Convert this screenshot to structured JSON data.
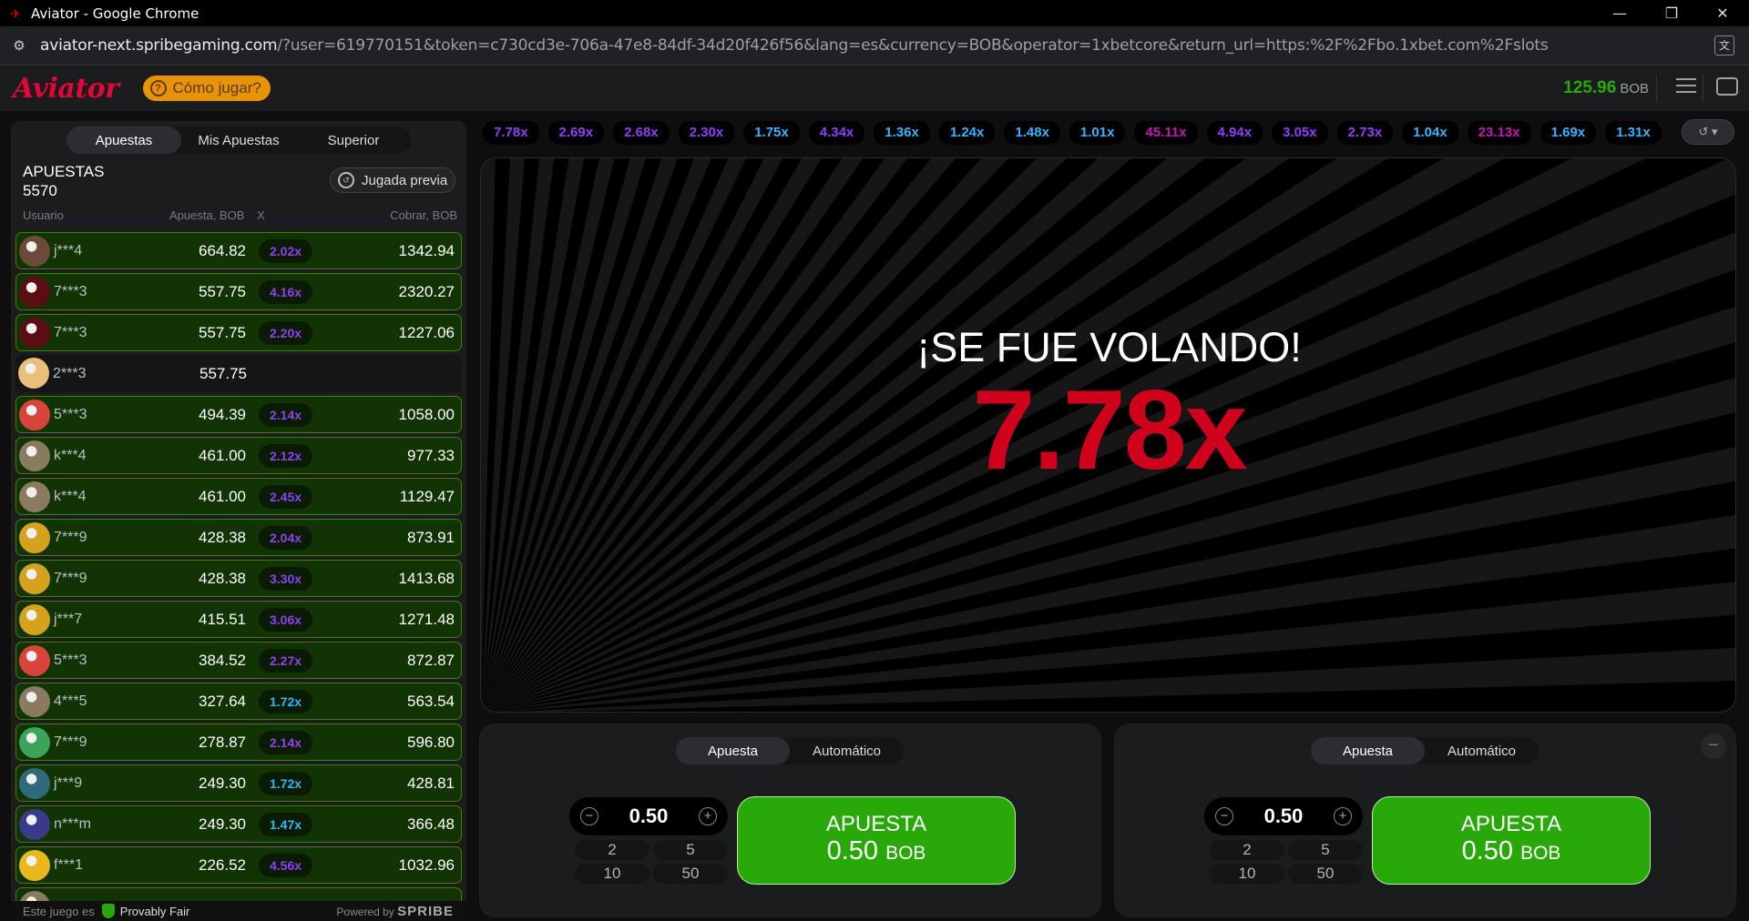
{
  "window": {
    "title": "Aviator - Google Chrome",
    "min": "—",
    "restore": "❐",
    "close": "✕"
  },
  "address": {
    "host": "aviator-next.spribegaming.com",
    "path": "/?user=619770151&token=c730cd3e-706a-47e8-84df-34d20f426f56&lang=es&currency=BOB&operator=1xbetcore&return_url=https:%2F%2Fbo.1xbet.com%2Fslots"
  },
  "header": {
    "logo": "Aviator",
    "howto": "Cómo jugar?",
    "balance": "125.96",
    "currency": "BOB"
  },
  "left": {
    "tabs": [
      "Apuestas",
      "Mis Apuestas",
      "Superior"
    ],
    "title": "APUESTAS",
    "count": "5570",
    "prev_button": "Jugada previa",
    "columns": {
      "user": "Usuario",
      "bet": "Apuesta, BOB",
      "x": "X",
      "cashout": "Cobrar, BOB"
    },
    "rows": [
      {
        "user": "j***4",
        "bet": "664.82",
        "x": "2.02x",
        "cashout": "1342.94",
        "win": true,
        "xcolor": "#913ef8",
        "av": "#6b4a3a"
      },
      {
        "user": "7***3",
        "bet": "557.75",
        "x": "4.16x",
        "cashout": "2320.27",
        "win": true,
        "xcolor": "#913ef8",
        "av": "#5a0d12"
      },
      {
        "user": "7***3",
        "bet": "557.75",
        "x": "2.20x",
        "cashout": "1227.06",
        "win": true,
        "xcolor": "#913ef8",
        "av": "#5a0d12"
      },
      {
        "user": "2***3",
        "bet": "557.75",
        "x": "",
        "cashout": "",
        "win": false,
        "xcolor": "#913ef8",
        "av": "#e8c07a"
      },
      {
        "user": "5***3",
        "bet": "494.39",
        "x": "2.14x",
        "cashout": "1058.00",
        "win": true,
        "xcolor": "#913ef8",
        "av": "#d9443a"
      },
      {
        "user": "k***4",
        "bet": "461.00",
        "x": "2.12x",
        "cashout": "977.33",
        "win": true,
        "xcolor": "#913ef8",
        "av": "#8a7a60"
      },
      {
        "user": "k***4",
        "bet": "461.00",
        "x": "2.45x",
        "cashout": "1129.47",
        "win": true,
        "xcolor": "#913ef8",
        "av": "#8a7a60"
      },
      {
        "user": "7***9",
        "bet": "428.38",
        "x": "2.04x",
        "cashout": "873.91",
        "win": true,
        "xcolor": "#913ef8",
        "av": "#d4a21c"
      },
      {
        "user": "7***9",
        "bet": "428.38",
        "x": "3.30x",
        "cashout": "1413.68",
        "win": true,
        "xcolor": "#913ef8",
        "av": "#d4a21c"
      },
      {
        "user": "j***7",
        "bet": "415.51",
        "x": "3.06x",
        "cashout": "1271.48",
        "win": true,
        "xcolor": "#913ef8",
        "av": "#d4a21c"
      },
      {
        "user": "5***3",
        "bet": "384.52",
        "x": "2.27x",
        "cashout": "872.87",
        "win": true,
        "xcolor": "#913ef8",
        "av": "#d9443a"
      },
      {
        "user": "4***5",
        "bet": "327.64",
        "x": "1.72x",
        "cashout": "563.54",
        "win": true,
        "xcolor": "#34b4ff",
        "av": "#8a7a60"
      },
      {
        "user": "7***9",
        "bet": "278.87",
        "x": "2.14x",
        "cashout": "596.80",
        "win": true,
        "xcolor": "#913ef8",
        "av": "#3aa45a"
      },
      {
        "user": "j***9",
        "bet": "249.30",
        "x": "1.72x",
        "cashout": "428.81",
        "win": true,
        "xcolor": "#34b4ff",
        "av": "#2e6a7a"
      },
      {
        "user": "n***m",
        "bet": "249.30",
        "x": "1.47x",
        "cashout": "366.48",
        "win": true,
        "xcolor": "#34b4ff",
        "av": "#3a3a8a"
      },
      {
        "user": "f***1",
        "bet": "226.52",
        "x": "4.56x",
        "cashout": "1032.96",
        "win": true,
        "xcolor": "#913ef8",
        "av": "#e8b81c"
      },
      {
        "user": "",
        "bet": "",
        "x": "",
        "cashout": "",
        "win": true,
        "xcolor": "#913ef8",
        "av": "#8a7a60"
      }
    ],
    "footer": {
      "prefix": "Este juego es",
      "provably": "Provably Fair",
      "powered": "Powered by",
      "brand": "SPRIBE"
    }
  },
  "history": [
    {
      "v": "7.78x",
      "c": "#913ef8"
    },
    {
      "v": "2.69x",
      "c": "#913ef8"
    },
    {
      "v": "2.68x",
      "c": "#913ef8"
    },
    {
      "v": "2.30x",
      "c": "#913ef8"
    },
    {
      "v": "1.75x",
      "c": "#34b4ff"
    },
    {
      "v": "4.34x",
      "c": "#913ef8"
    },
    {
      "v": "1.36x",
      "c": "#34b4ff"
    },
    {
      "v": "1.24x",
      "c": "#34b4ff"
    },
    {
      "v": "1.48x",
      "c": "#34b4ff"
    },
    {
      "v": "1.01x",
      "c": "#34b4ff"
    },
    {
      "v": "45.11x",
      "c": "#c017b4"
    },
    {
      "v": "4.94x",
      "c": "#913ef8"
    },
    {
      "v": "3.05x",
      "c": "#913ef8"
    },
    {
      "v": "2.73x",
      "c": "#913ef8"
    },
    {
      "v": "1.04x",
      "c": "#34b4ff"
    },
    {
      "v": "23.13x",
      "c": "#c017b4"
    },
    {
      "v": "1.69x",
      "c": "#34b4ff"
    },
    {
      "v": "1.31x",
      "c": "#34b4ff"
    }
  ],
  "stage": {
    "flew": "¡SE FUE VOLANDO!",
    "crash": "7.78x"
  },
  "betpanels": [
    {
      "tabs": [
        "Apuesta",
        "Automático"
      ],
      "stake": "0.50",
      "quick": [
        "2",
        "5",
        "10",
        "50"
      ],
      "btn_label": "APUESTA",
      "btn_amount": "0.50",
      "btn_cur": "BOB"
    },
    {
      "tabs": [
        "Apuesta",
        "Automático"
      ],
      "stake": "0.50",
      "quick": [
        "2",
        "5",
        "10",
        "50"
      ],
      "btn_label": "APUESTA",
      "btn_amount": "0.50",
      "btn_cur": "BOB"
    }
  ]
}
